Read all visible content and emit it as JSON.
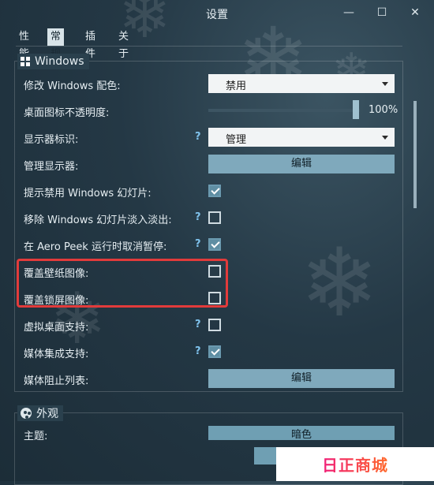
{
  "window": {
    "title": "设置",
    "minimize": "—",
    "maximize": "☐",
    "close": "✕"
  },
  "tabs": [
    {
      "label": "性能"
    },
    {
      "label": "常规",
      "active": true
    },
    {
      "label": "插件"
    },
    {
      "label": "关于"
    }
  ],
  "windows_group": {
    "title": "Windows",
    "rows": [
      {
        "label": "修改 Windows 配色:",
        "type": "dropdown",
        "value": "禁用"
      },
      {
        "label": "桌面图标不透明度:",
        "type": "slider",
        "value_text": "100%",
        "level": 1.0
      },
      {
        "label": "显示器标识:",
        "type": "dropdown",
        "help": "?",
        "value": "管理"
      },
      {
        "label": "管理显示器:",
        "type": "button",
        "value": "编辑"
      },
      {
        "label": "提示禁用 Windows 幻灯片:",
        "type": "checkbox",
        "checked": true
      },
      {
        "label": "移除 Windows 幻灯片淡入淡出:",
        "type": "checkbox",
        "help": "?",
        "checked": false
      },
      {
        "label": "在 Aero Peek 运行时取消暂停:",
        "type": "checkbox",
        "help": "?",
        "checked": true
      },
      {
        "label": "覆盖壁纸图像:",
        "type": "checkbox",
        "checked": false
      },
      {
        "label": "覆盖锁屏图像:",
        "type": "checkbox",
        "checked": false
      },
      {
        "label": "虚拟桌面支持:",
        "type": "checkbox",
        "help": "?",
        "checked": false
      },
      {
        "label": "媒体集成支持:",
        "type": "checkbox",
        "help": "?",
        "checked": true
      },
      {
        "label": "媒体阻止列表:",
        "type": "button",
        "value": "编辑"
      }
    ]
  },
  "appearance_group": {
    "title": "外观",
    "first_row_label": "主题:",
    "first_row_value": "暗色"
  },
  "watermark": "日正商城",
  "colors": {
    "accent": "#7fa9bc",
    "highlight": "#e23b3b",
    "help": "#7fc2ec"
  }
}
